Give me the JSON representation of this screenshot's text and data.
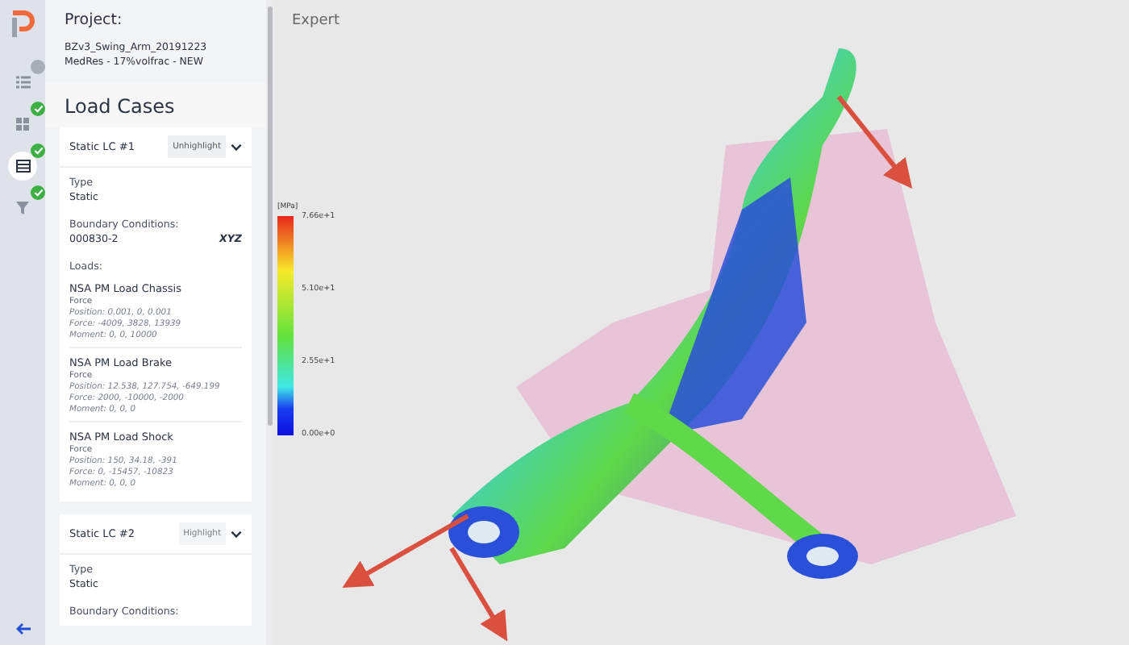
{
  "rail": {
    "items": [
      {
        "kind": "list",
        "complete": false,
        "selected": false
      },
      {
        "kind": "grid",
        "complete": true,
        "selected": false
      },
      {
        "kind": "table",
        "complete": true,
        "selected": true
      },
      {
        "kind": "filter",
        "complete": true,
        "selected": false
      }
    ]
  },
  "project": {
    "label": "Project:",
    "name": "BZv3_Swing_Arm_20191223",
    "variant": "MedRes - 17%volfrac - NEW"
  },
  "load_cases_title": "Load Cases",
  "load_cases": [
    {
      "title": "Static LC #1",
      "button": "Unhighlight",
      "highlighted": true,
      "type_label": "Type",
      "type": "Static",
      "bc_label": "Boundary Conditions:",
      "bc": "000830-2",
      "bc_axes": "XYZ",
      "loads_label": "Loads:",
      "loads": [
        {
          "name": "NSA PM Load Chassis",
          "kind": "Force",
          "position": "Position: 0.001, 0, 0.001",
          "force": "Force: -4009, 3828, 13939",
          "moment": "Moment: 0, 0, 10000"
        },
        {
          "name": "NSA PM Load Brake",
          "kind": "Force",
          "position": "Position: 12.538, 127.754, -649.199",
          "force": "Force: 2000, -10000, -2000",
          "moment": "Moment: 0, 0, 0"
        },
        {
          "name": "NSA PM Load Shock",
          "kind": "Force",
          "position": "Position: 150, 34.18, -391",
          "force": "Force: 0, -15457, -10823",
          "moment": "Moment: 0, 0, 0"
        }
      ]
    },
    {
      "title": "Static LC #2",
      "button": "Highlight",
      "highlighted": false,
      "type_label": "Type",
      "type": "Static",
      "bc_label": "Boundary Conditions:"
    }
  ],
  "viewport": {
    "mode": "Expert",
    "legend": {
      "unit": "[MPa]",
      "ticks": [
        "7.66e+1",
        "5.10e+1",
        "2.55e+1",
        "0.00e+0"
      ]
    }
  }
}
